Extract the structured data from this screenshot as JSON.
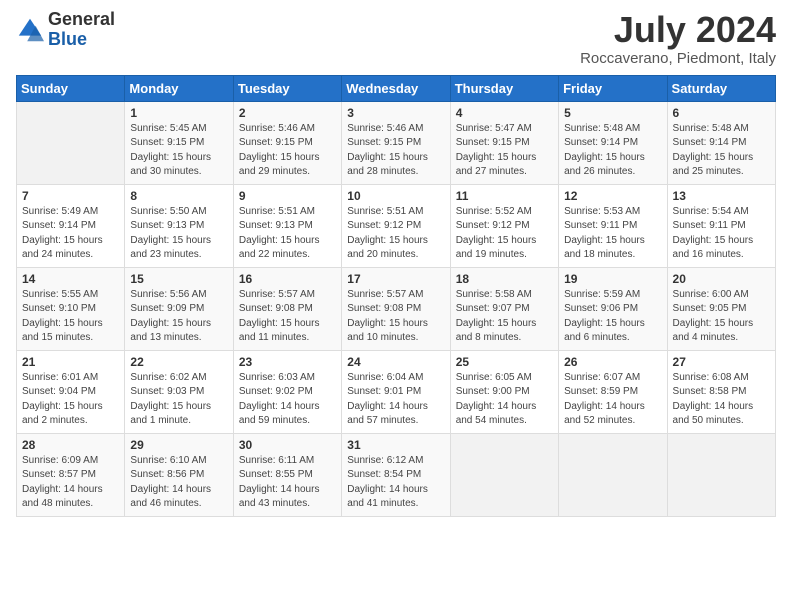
{
  "logo": {
    "general": "General",
    "blue": "Blue"
  },
  "title": "July 2024",
  "subtitle": "Roccaverano, Piedmont, Italy",
  "days_of_week": [
    "Sunday",
    "Monday",
    "Tuesday",
    "Wednesday",
    "Thursday",
    "Friday",
    "Saturday"
  ],
  "weeks": [
    [
      {
        "day": "",
        "info": ""
      },
      {
        "day": "1",
        "info": "Sunrise: 5:45 AM\nSunset: 9:15 PM\nDaylight: 15 hours\nand 30 minutes."
      },
      {
        "day": "2",
        "info": "Sunrise: 5:46 AM\nSunset: 9:15 PM\nDaylight: 15 hours\nand 29 minutes."
      },
      {
        "day": "3",
        "info": "Sunrise: 5:46 AM\nSunset: 9:15 PM\nDaylight: 15 hours\nand 28 minutes."
      },
      {
        "day": "4",
        "info": "Sunrise: 5:47 AM\nSunset: 9:15 PM\nDaylight: 15 hours\nand 27 minutes."
      },
      {
        "day": "5",
        "info": "Sunrise: 5:48 AM\nSunset: 9:14 PM\nDaylight: 15 hours\nand 26 minutes."
      },
      {
        "day": "6",
        "info": "Sunrise: 5:48 AM\nSunset: 9:14 PM\nDaylight: 15 hours\nand 25 minutes."
      }
    ],
    [
      {
        "day": "7",
        "info": "Sunrise: 5:49 AM\nSunset: 9:14 PM\nDaylight: 15 hours\nand 24 minutes."
      },
      {
        "day": "8",
        "info": "Sunrise: 5:50 AM\nSunset: 9:13 PM\nDaylight: 15 hours\nand 23 minutes."
      },
      {
        "day": "9",
        "info": "Sunrise: 5:51 AM\nSunset: 9:13 PM\nDaylight: 15 hours\nand 22 minutes."
      },
      {
        "day": "10",
        "info": "Sunrise: 5:51 AM\nSunset: 9:12 PM\nDaylight: 15 hours\nand 20 minutes."
      },
      {
        "day": "11",
        "info": "Sunrise: 5:52 AM\nSunset: 9:12 PM\nDaylight: 15 hours\nand 19 minutes."
      },
      {
        "day": "12",
        "info": "Sunrise: 5:53 AM\nSunset: 9:11 PM\nDaylight: 15 hours\nand 18 minutes."
      },
      {
        "day": "13",
        "info": "Sunrise: 5:54 AM\nSunset: 9:11 PM\nDaylight: 15 hours\nand 16 minutes."
      }
    ],
    [
      {
        "day": "14",
        "info": "Sunrise: 5:55 AM\nSunset: 9:10 PM\nDaylight: 15 hours\nand 15 minutes."
      },
      {
        "day": "15",
        "info": "Sunrise: 5:56 AM\nSunset: 9:09 PM\nDaylight: 15 hours\nand 13 minutes."
      },
      {
        "day": "16",
        "info": "Sunrise: 5:57 AM\nSunset: 9:08 PM\nDaylight: 15 hours\nand 11 minutes."
      },
      {
        "day": "17",
        "info": "Sunrise: 5:57 AM\nSunset: 9:08 PM\nDaylight: 15 hours\nand 10 minutes."
      },
      {
        "day": "18",
        "info": "Sunrise: 5:58 AM\nSunset: 9:07 PM\nDaylight: 15 hours\nand 8 minutes."
      },
      {
        "day": "19",
        "info": "Sunrise: 5:59 AM\nSunset: 9:06 PM\nDaylight: 15 hours\nand 6 minutes."
      },
      {
        "day": "20",
        "info": "Sunrise: 6:00 AM\nSunset: 9:05 PM\nDaylight: 15 hours\nand 4 minutes."
      }
    ],
    [
      {
        "day": "21",
        "info": "Sunrise: 6:01 AM\nSunset: 9:04 PM\nDaylight: 15 hours\nand 2 minutes."
      },
      {
        "day": "22",
        "info": "Sunrise: 6:02 AM\nSunset: 9:03 PM\nDaylight: 15 hours\nand 1 minute."
      },
      {
        "day": "23",
        "info": "Sunrise: 6:03 AM\nSunset: 9:02 PM\nDaylight: 14 hours\nand 59 minutes."
      },
      {
        "day": "24",
        "info": "Sunrise: 6:04 AM\nSunset: 9:01 PM\nDaylight: 14 hours\nand 57 minutes."
      },
      {
        "day": "25",
        "info": "Sunrise: 6:05 AM\nSunset: 9:00 PM\nDaylight: 14 hours\nand 54 minutes."
      },
      {
        "day": "26",
        "info": "Sunrise: 6:07 AM\nSunset: 8:59 PM\nDaylight: 14 hours\nand 52 minutes."
      },
      {
        "day": "27",
        "info": "Sunrise: 6:08 AM\nSunset: 8:58 PM\nDaylight: 14 hours\nand 50 minutes."
      }
    ],
    [
      {
        "day": "28",
        "info": "Sunrise: 6:09 AM\nSunset: 8:57 PM\nDaylight: 14 hours\nand 48 minutes."
      },
      {
        "day": "29",
        "info": "Sunrise: 6:10 AM\nSunset: 8:56 PM\nDaylight: 14 hours\nand 46 minutes."
      },
      {
        "day": "30",
        "info": "Sunrise: 6:11 AM\nSunset: 8:55 PM\nDaylight: 14 hours\nand 43 minutes."
      },
      {
        "day": "31",
        "info": "Sunrise: 6:12 AM\nSunset: 8:54 PM\nDaylight: 14 hours\nand 41 minutes."
      },
      {
        "day": "",
        "info": ""
      },
      {
        "day": "",
        "info": ""
      },
      {
        "day": "",
        "info": ""
      }
    ]
  ]
}
